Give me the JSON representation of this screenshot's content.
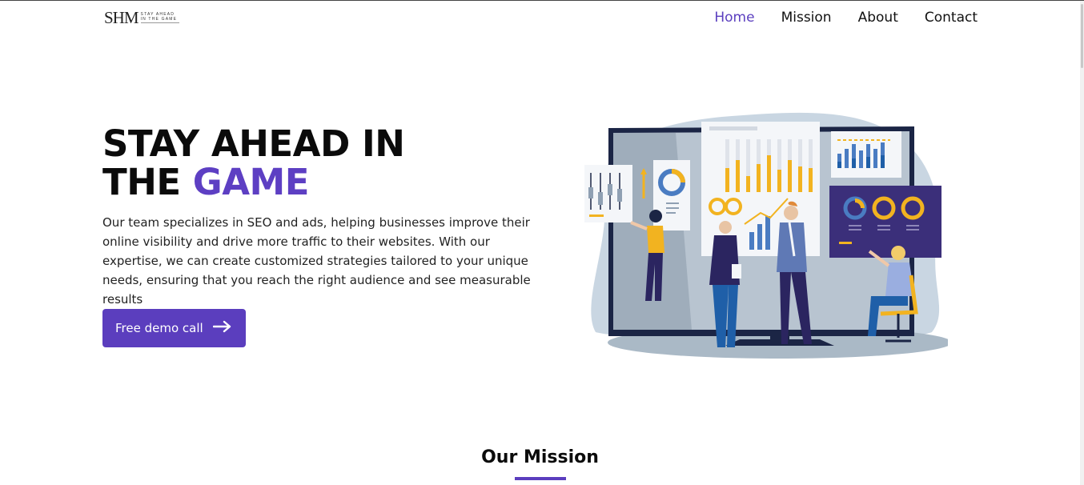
{
  "logo": {
    "mark": "SHM",
    "tagline_line1": "STAY AHEAD",
    "tagline_line2": "IN THE GAME"
  },
  "nav": {
    "items": [
      {
        "label": "Home",
        "active": true
      },
      {
        "label": "Mission",
        "active": false
      },
      {
        "label": "About",
        "active": false
      },
      {
        "label": "Contact",
        "active": false
      }
    ]
  },
  "hero": {
    "title_line1": "STAY AHEAD IN",
    "title_line2_prefix": "THE ",
    "title_line2_accent": "GAME",
    "description": "Our team specializes in SEO and ads, helping businesses improve their online visibility and drive more traffic to their websites. With our expertise, we can create customized strategies tailored to your unique needs, ensuring that you reach the right audience and see measurable results",
    "cta_label": "Free demo call",
    "cta_icon": "arrow-right-icon"
  },
  "mission": {
    "title": "Our Mission"
  },
  "colors": {
    "accent": "#5b3ebe",
    "text": "#111111"
  }
}
